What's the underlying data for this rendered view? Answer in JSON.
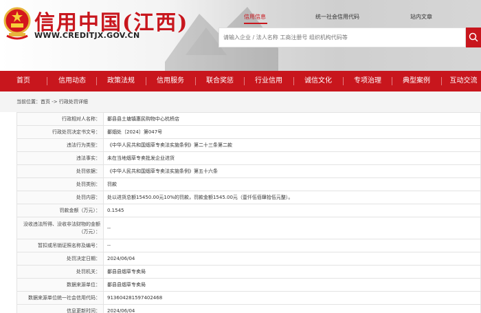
{
  "header": {
    "site_title": "信用中国(江西)",
    "site_url": "WWW.CREDITJX.GOV.CN",
    "top_links": [
      "信用信息",
      "统一社会信用代码",
      "站内文章"
    ],
    "active_top_link": "信用信息",
    "search_placeholder": "请输入企业 / 法人名称 工商注册号 组织机构代码等",
    "brand_color": "#c8161d"
  },
  "nav": {
    "items": [
      "首页",
      "信用动态",
      "政策法规",
      "信用服务",
      "联合奖惩",
      "行业信用",
      "诚信文化",
      "专项治理",
      "典型案例",
      "互动交流"
    ]
  },
  "breadcrumb": {
    "prefix": "当前位置：",
    "path": "首页 -> 行政处罚详细"
  },
  "details": {
    "rows": [
      {
        "label": "行政相对人名称：",
        "value": "鄱县县土塘镇惠民购物中心杭桥店"
      },
      {
        "label": "行政处罚决定书文号：",
        "value": "鄱烟处〔2024〕第047号"
      },
      {
        "label": "违法行为类型：",
        "value": "《中华人民共和国烟草专卖法实施条例》第二十三条第二款"
      },
      {
        "label": "违法事实：",
        "value": "未在当地烟草专卖批发企业进货"
      },
      {
        "label": "处罚依据：",
        "value": "《中华人民共和国烟草专卖法实施条例》第五十六条"
      },
      {
        "label": "处罚类别：",
        "value": "罚款"
      },
      {
        "label": "处罚内容：",
        "value": "处以进货总额15450.00元10%的罚款，罚款金额1545.00元（壹仟伍佰肆拾伍元整）。"
      },
      {
        "label": "罚款金额（万元）：",
        "value": "0.1545"
      },
      {
        "label": "没收违法所得、没收非法财物的金额（万元）：",
        "value": "--"
      },
      {
        "label": "暂扣或吊销证照名称及编号：",
        "value": "--"
      },
      {
        "label": "处罚决定日期：",
        "value": "2024/06/04"
      },
      {
        "label": "处罚机关：",
        "value": "鄱县县烟草专卖局"
      },
      {
        "label": "数据来源单位：",
        "value": "鄱县县烟草专卖局"
      },
      {
        "label": "数据来源单位统一社会信用代码：",
        "value": "913604281597402468"
      },
      {
        "label": "信息更新时间：",
        "value": "2024/06/04"
      }
    ]
  },
  "icons": [
    "national-emblem-icon",
    "search-icon"
  ]
}
